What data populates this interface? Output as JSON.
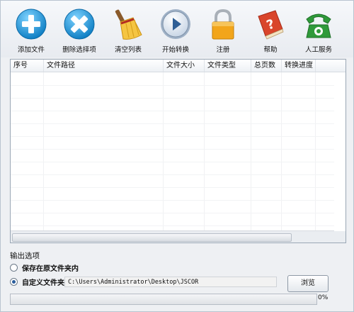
{
  "toolbar": {
    "buttons": [
      {
        "label": "添加文件",
        "icon": "add-plus-icon"
      },
      {
        "label": "删除选择项",
        "icon": "delete-x-icon"
      },
      {
        "label": "清空列表",
        "icon": "broom-icon"
      },
      {
        "label": "开始转换",
        "icon": "play-icon"
      },
      {
        "label": "注册",
        "icon": "lock-icon"
      },
      {
        "label": "帮助",
        "icon": "help-book-icon"
      },
      {
        "label": "人工服务",
        "icon": "phone-icon"
      }
    ]
  },
  "table": {
    "columns": [
      "序号",
      "文件路径",
      "文件大小",
      "文件类型",
      "总页数",
      "转换进度"
    ],
    "rows": []
  },
  "output": {
    "title": "输出选项",
    "option_original": "保存在原文件夹内",
    "option_custom": "自定义文件夹",
    "selected": "option_custom",
    "path": "C:\\Users\\Administrator\\Desktop\\JSCOR",
    "browse_label": "浏览"
  },
  "progress": {
    "value": 0,
    "label": "0%"
  },
  "colors": {
    "add_blue": "#1f96d6",
    "delete_blue": "#1f96d6",
    "lock_orange": "#f2a51b",
    "help_red": "#d9452b",
    "phone_green": "#2f9a3a"
  }
}
